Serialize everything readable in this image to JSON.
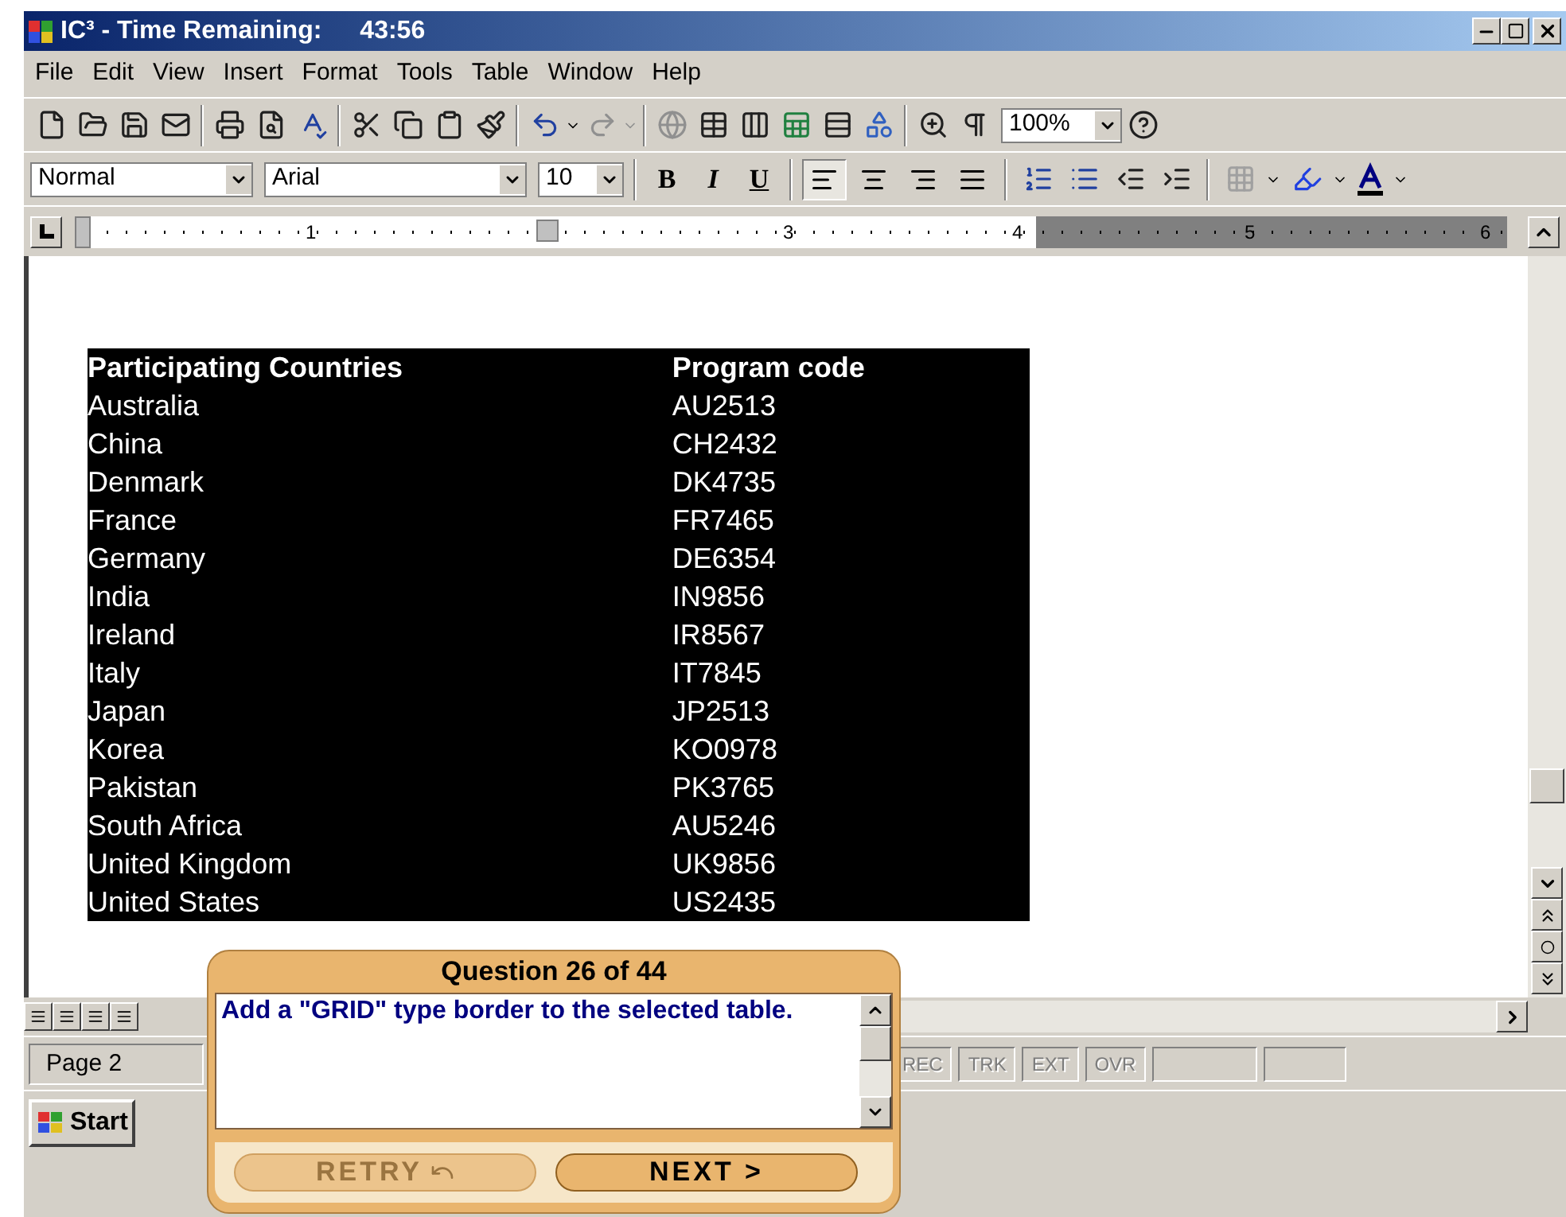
{
  "window": {
    "title": "IC³ - Time Remaining:",
    "time": "43:56"
  },
  "menu": [
    "File",
    "Edit",
    "View",
    "Insert",
    "Format",
    "Tools",
    "Table",
    "Window",
    "Help"
  ],
  "toolbar": {
    "zoom": "100%"
  },
  "formatting": {
    "style": "Normal",
    "font": "Arial",
    "size": "10",
    "bold": "B",
    "italic": "I",
    "underline": "U",
    "alignment": [
      {
        "kind": "left",
        "selected": true
      },
      {
        "kind": "center",
        "selected": false
      },
      {
        "kind": "right",
        "selected": false
      },
      {
        "kind": "justify",
        "selected": false
      }
    ]
  },
  "ruler": {
    "labels": [
      "1",
      "3",
      "4",
      "5",
      "6"
    ]
  },
  "table": {
    "columns": [
      "Participating Countries",
      "Program code"
    ],
    "rows": [
      [
        "Australia",
        "AU2513"
      ],
      [
        "China",
        "CH2432"
      ],
      [
        "Denmark",
        "DK4735"
      ],
      [
        "France",
        "FR7465"
      ],
      [
        "Germany",
        "DE6354"
      ],
      [
        "India",
        "IN9856"
      ],
      [
        "Ireland",
        "IR8567"
      ],
      [
        "Italy",
        "IT7845"
      ],
      [
        "Japan",
        "JP2513"
      ],
      [
        "Korea",
        "KO0978"
      ],
      [
        "Pakistan",
        "PK3765"
      ],
      [
        "South Africa",
        "AU5246"
      ],
      [
        "United Kingdom",
        "UK9856"
      ],
      [
        "United States",
        "US2435"
      ]
    ]
  },
  "status_bar": {
    "page": "Page 2",
    "indicators": [
      {
        "label": "REC",
        "disabled": true
      },
      {
        "label": "TRK",
        "disabled": true
      },
      {
        "label": "EXT",
        "disabled": true
      },
      {
        "label": "OVR",
        "disabled": true
      }
    ]
  },
  "taskbar": {
    "start": "Start"
  },
  "question": {
    "title": "Question 26 of 44",
    "text": "Add a \"GRID\" type border to the selected table.",
    "buttons": [
      {
        "label": "RETRY",
        "disabled": true
      },
      {
        "label": "NEXT >",
        "disabled": false
      }
    ]
  }
}
